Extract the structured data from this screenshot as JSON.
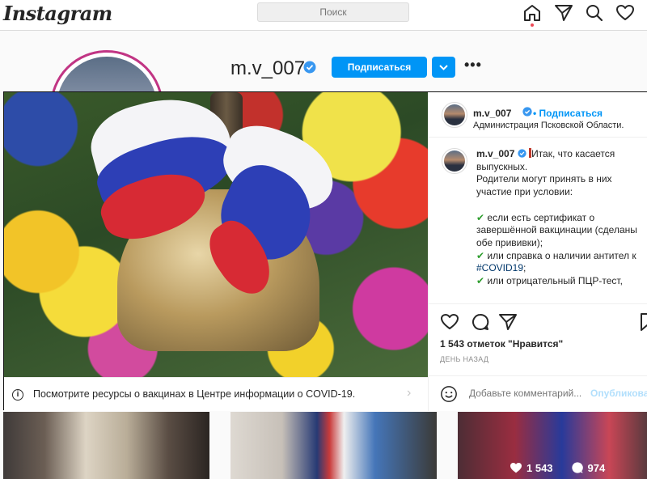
{
  "topbar": {
    "logo": "Instagram",
    "search_placeholder": "Поиск",
    "icons": [
      "home-icon",
      "direct-icon",
      "explore-icon",
      "activity-icon"
    ]
  },
  "profile": {
    "username": "m.v_007",
    "subscribe_label": "Подписаться",
    "more_label": "•••"
  },
  "post": {
    "info_strip": "Посмотрите ресурсы о вакцинах в Центре информации о COVID-19.",
    "header": {
      "username": "m.v_007",
      "dot": "•",
      "follow_label": "Подписаться",
      "location": "Администрация Псковской Области."
    },
    "caption": {
      "username": "m.v_007",
      "line1": "Итак, что касается выпускных.",
      "line2": "Родители могут принять в них участие при условии:",
      "item1": "если есть сертификат о завершённой вакцинации (сделаны обе прививки);",
      "item2_prefix": "или справка о наличии антител к",
      "item2_tag": "#COVID19",
      "item2_suffix": ";",
      "item3": "или отрицательный ПЦР-тест,"
    },
    "likes_text": "1 543 отметок \"Нравится\"",
    "time_text": "ДЕНЬ НАЗАД",
    "comment_placeholder": "Добавьте комментарий...",
    "publish_label": "Опубликовать"
  },
  "grid": {
    "likes": "1 543",
    "comments": "974"
  },
  "colors": {
    "accent": "#0095f6",
    "check": "#2e9d2e",
    "verified": "#3897f0",
    "story_ring": "#c13584"
  }
}
